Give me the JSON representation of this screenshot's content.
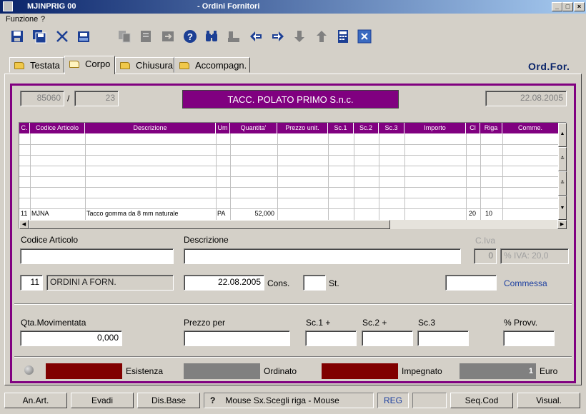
{
  "window": {
    "program": "MJINPRIG 00",
    "title": "- Ordini Fornitori"
  },
  "menu": {
    "items": [
      "Funzione",
      "?"
    ]
  },
  "toolbar": {
    "icons": [
      "save-icon",
      "save-all-icon",
      "delete-icon",
      "print-icon",
      "copy-icon",
      "page-icon",
      "export-icon",
      "help-icon",
      "search-icon",
      "stamp-icon",
      "arrow-left-icon",
      "arrow-right-icon",
      "arrow-down-icon",
      "arrow-up-icon",
      "calculator-icon",
      "close-icon"
    ]
  },
  "tabs": [
    {
      "label": "Testata"
    },
    {
      "label": "Corpo"
    },
    {
      "label": "Chiusura"
    },
    {
      "label": "Accompagn."
    }
  ],
  "doc_code": "Ord.For.",
  "header": {
    "order_number": "85060",
    "separator": "/",
    "order_suffix": "23",
    "supplier": "TACC. POLATO PRIMO S.n.c.",
    "date": "22.08.2005"
  },
  "grid": {
    "columns": [
      "C.",
      "Codice Articolo",
      "Descrizione",
      "Um",
      "Quantita'",
      "Prezzo unit.",
      "Sc.1",
      "Sc.2",
      "Sc.3",
      "Importo",
      "Cl",
      "Riga",
      "Comme."
    ],
    "rows": [
      {
        "c": "11",
        "codice": "MJNA",
        "descrizione": "Tacco gomma da 8 mm naturale",
        "um": "PA",
        "quantita": "52,000",
        "prezzo": "",
        "sc1": "",
        "sc2": "",
        "sc3": "",
        "importo": "",
        "cl": "20",
        "riga": "10",
        "comme": ""
      }
    ]
  },
  "form": {
    "codice_articolo_label": "Codice Articolo",
    "codice_articolo_value": "",
    "descrizione_label": "Descrizione",
    "descrizione_value": "",
    "civa_label": "C.Iva",
    "civa_value": "0",
    "perc_iva": "% IVA: 20,0",
    "causale_code": "11",
    "causale_desc": "ORDINI A FORN.",
    "cons_date": "22.08.2005",
    "cons_label": "Cons.",
    "st_label": "St.",
    "st_value": "",
    "commessa_value": "",
    "commessa_label": "Commessa",
    "qta_label": "Qta.Movimentata",
    "qta_value": "0,000",
    "prezzo_label": "Prezzo per",
    "prezzo_value": "",
    "sc1_label": "Sc.1 +",
    "sc2_label": "Sc.2 +",
    "sc3_label": "Sc.3",
    "prov_label": "% Provv."
  },
  "stock": {
    "esistenza_label": "Esistenza",
    "ordinato_label": "Ordinato",
    "impegnato_label": "Impegnato",
    "euro_value": "1",
    "euro_label": "Euro",
    "colors": {
      "esistenza": "#800000",
      "ordinato": "#808080",
      "impegnato": "#800000"
    }
  },
  "statusbar": {
    "btn_anart": "An.Art.",
    "btn_evadi": "Evadi",
    "btn_disbase": "Dis.Base",
    "help_mark": "?",
    "message": "Mouse Sx.Scegli riga - Mouse",
    "mode": "REG",
    "btn_seqcod": "Seq.Cod",
    "btn_visual": "Visual."
  }
}
